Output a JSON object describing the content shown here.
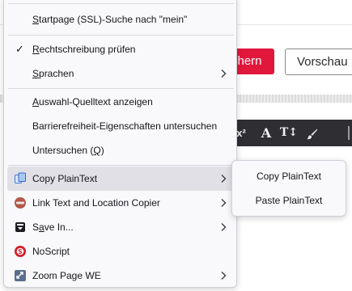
{
  "background": {
    "save_button": "chern",
    "preview_button": "Vorschau",
    "editor_tools": [
      "x²",
      "A",
      "T↕",
      "🖌"
    ]
  },
  "menu": {
    "search_item": {
      "label": "Startpage (SSL)-Suche nach \"mein\"",
      "access": "S"
    },
    "spellcheck_item": {
      "label": "Rechtschreibung prüfen",
      "checked": true
    },
    "languages_item": {
      "label": "Sprachen"
    },
    "view_selection_source": {
      "label": "Auswahl-Quelltext anzeigen"
    },
    "inspect_accessibility": {
      "label": "Barrierefreiheit-Eigenschaften untersuchen"
    },
    "inspect_item": {
      "label": "Untersuchen (Q)"
    },
    "extensions": [
      {
        "label": "Copy PlainText",
        "icon": "copy-plaintext-icon",
        "has_submenu": true,
        "highlighted": true
      },
      {
        "label": "Link Text and Location Copier",
        "icon": "link-copier-icon",
        "has_submenu": true
      },
      {
        "label": "Save In...",
        "icon": "save-in-icon",
        "has_submenu": true
      },
      {
        "label": "NoScript",
        "icon": "noscript-icon",
        "has_submenu": false
      },
      {
        "label": "Zoom Page WE",
        "icon": "zoom-page-icon",
        "has_submenu": true
      }
    ]
  },
  "submenu": {
    "items": [
      {
        "label": "Copy PlainText"
      },
      {
        "label": "Paste PlainText"
      }
    ]
  },
  "colors": {
    "menu_bg": "#f9f9fb",
    "highlight": "#e0e0e6",
    "save_button": "#e1173c",
    "editor_bar": "#2f2f33"
  }
}
